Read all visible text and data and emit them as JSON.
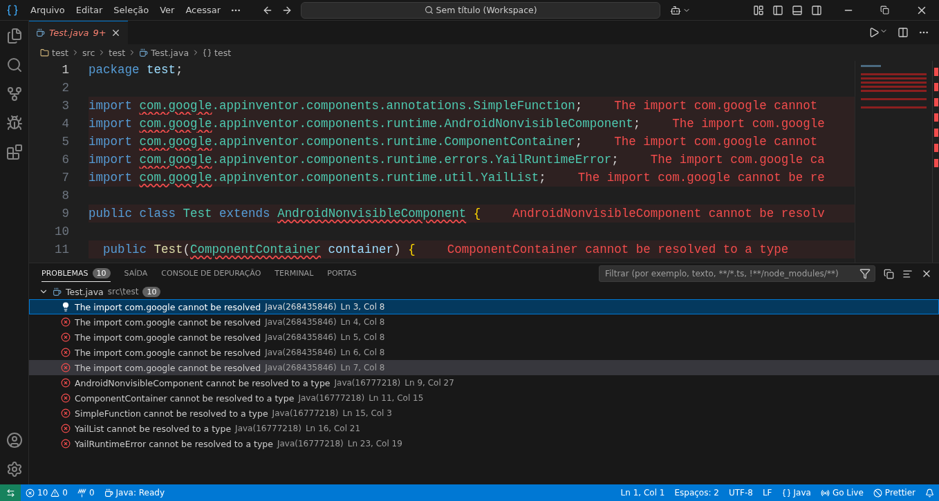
{
  "title_bar": {
    "menu": [
      "Arquivo",
      "Editar",
      "Seleção",
      "Ver",
      "Acessar"
    ],
    "command_center": "Sem título (Workspace)"
  },
  "editor_tabs": [
    {
      "label": "Test.java",
      "badge": "9+",
      "selected": true,
      "has_errors": true
    }
  ],
  "breadcrumb": [
    {
      "kind": "folder",
      "label": "test"
    },
    {
      "kind": "plain",
      "label": "src"
    },
    {
      "kind": "plain",
      "label": "test"
    },
    {
      "kind": "file",
      "label": "Test.java"
    },
    {
      "kind": "symbol",
      "label": "test"
    }
  ],
  "code_lines": [
    {
      "number": "1",
      "error_line": false,
      "tokens": [
        {
          "kind": "keyword",
          "text": "package"
        },
        {
          "kind": "variable",
          "text": "test"
        },
        {
          "kind": "plain",
          "text": ";",
          "attached": true
        }
      ]
    },
    {
      "number": "2",
      "error_line": false
    },
    {
      "number": "3",
      "error_line": true,
      "message": "The import com.google cannot",
      "tokens": [
        {
          "kind": "keyword",
          "text": "import"
        },
        {
          "kind": "type",
          "text": "com.google",
          "error": true
        },
        {
          "kind": "type",
          "text": ".appinventor.components.annotations.SimpleFunction",
          "attached": true
        },
        {
          "kind": "plain",
          "text": ";",
          "attached": true
        }
      ]
    },
    {
      "number": "4",
      "error_line": true,
      "message": "The import com.google",
      "tokens": [
        {
          "kind": "keyword",
          "text": "import"
        },
        {
          "kind": "type",
          "text": "com.google",
          "error": true
        },
        {
          "kind": "type",
          "text": ".appinventor.components.runtime.AndroidNonvisibleComponent",
          "attached": true
        },
        {
          "kind": "plain",
          "text": ";",
          "attached": true
        }
      ]
    },
    {
      "number": "5",
      "error_line": true,
      "message": "The import com.google cannot",
      "tokens": [
        {
          "kind": "keyword",
          "text": "import"
        },
        {
          "kind": "type",
          "text": "com.google",
          "error": true
        },
        {
          "kind": "type",
          "text": ".appinventor.components.runtime.ComponentContainer",
          "attached": true
        },
        {
          "kind": "plain",
          "text": ";",
          "attached": true
        }
      ]
    },
    {
      "number": "6",
      "error_line": true,
      "message": "The import com.google ca",
      "tokens": [
        {
          "kind": "keyword",
          "text": "import"
        },
        {
          "kind": "type",
          "text": "com.google",
          "error": true
        },
        {
          "kind": "type",
          "text": ".appinventor.components.runtime.errors.YailRuntimeError",
          "attached": true
        },
        {
          "kind": "plain",
          "text": ";",
          "attached": true
        }
      ]
    },
    {
      "number": "7",
      "error_line": true,
      "message": "The import com.google cannot be re",
      "tokens": [
        {
          "kind": "keyword",
          "text": "import"
        },
        {
          "kind": "type",
          "text": "com.google",
          "error": true
        },
        {
          "kind": "type",
          "text": ".appinventor.components.runtime.util.YailList",
          "attached": true
        },
        {
          "kind": "plain",
          "text": ";",
          "attached": true
        }
      ]
    },
    {
      "number": "8",
      "error_line": false
    },
    {
      "number": "9",
      "error_line": true,
      "message": "AndroidNonvisibleComponent cannot be resolv",
      "tokens": [
        {
          "kind": "keyword",
          "text": "public"
        },
        {
          "kind": "keyword",
          "text": "class"
        },
        {
          "kind": "type",
          "text": "Test"
        },
        {
          "kind": "keyword",
          "text": "extends"
        },
        {
          "kind": "type",
          "text": "AndroidNonvisibleComponent",
          "error": true
        },
        {
          "kind": "bracket",
          "text": "{"
        }
      ]
    },
    {
      "number": "10",
      "error_line": false
    },
    {
      "number": "11",
      "error_line": true,
      "indented": true,
      "message": "ComponentContainer cannot be resolved to a type",
      "tokens": [
        {
          "kind": "keyword",
          "text": "public"
        },
        {
          "kind": "method",
          "text": "Test"
        },
        {
          "kind": "plain",
          "text": "(",
          "attached": true
        },
        {
          "kind": "type",
          "text": "ComponentContainer",
          "error": true,
          "attached": true
        },
        {
          "kind": "variable",
          "text": "container"
        },
        {
          "kind": "plain",
          "text": ")",
          "attached": true
        },
        {
          "kind": "bracket",
          "text": "{"
        }
      ]
    }
  ],
  "panel": {
    "tabs": [
      {
        "label": "PROBLEMAS",
        "badge": "10",
        "selected": true
      },
      {
        "label": "SAÍDA",
        "selected": false
      },
      {
        "label": "CONSOLE DE DEPURAÇÃO",
        "selected": false
      },
      {
        "label": "TERMINAL",
        "selected": false
      },
      {
        "label": "PORTAS",
        "selected": false
      }
    ],
    "filter": {
      "placeholder": "Filtrar (por exemplo, texto, **/*.ts, !**/node_modules/**)"
    },
    "file_group": {
      "name": "Test.java",
      "path": "src\\test",
      "count": "10",
      "expanded": true
    },
    "problems": [
      {
        "kind": "quickfix",
        "message": "The import com.google cannot be resolved",
        "source": "Java(268435846)",
        "location": "Ln 3, Col 8",
        "selected": true,
        "hovered": false
      },
      {
        "kind": "error",
        "message": "The import com.google cannot be resolved",
        "source": "Java(268435846)",
        "location": "Ln 4, Col 8",
        "selected": false,
        "hovered": false
      },
      {
        "kind": "error",
        "message": "The import com.google cannot be resolved",
        "source": "Java(268435846)",
        "location": "Ln 5, Col 8",
        "selected": false,
        "hovered": false
      },
      {
        "kind": "error",
        "message": "The import com.google cannot be resolved",
        "source": "Java(268435846)",
        "location": "Ln 6, Col 8",
        "selected": false,
        "hovered": false
      },
      {
        "kind": "error",
        "message": "The import com.google cannot be resolved",
        "source": "Java(268435846)",
        "location": "Ln 7, Col 8",
        "selected": false,
        "hovered": true
      },
      {
        "kind": "error",
        "message": "AndroidNonvisibleComponent cannot be resolved to a type",
        "source": "Java(16777218)",
        "location": "Ln 9, Col 27",
        "selected": false,
        "hovered": false
      },
      {
        "kind": "error",
        "message": "ComponentContainer cannot be resolved to a type",
        "source": "Java(16777218)",
        "location": "Ln 11, Col 15",
        "selected": false,
        "hovered": false
      },
      {
        "kind": "error",
        "message": "SimpleFunction cannot be resolved to a type",
        "source": "Java(16777218)",
        "location": "Ln 15, Col 3",
        "selected": false,
        "hovered": false
      },
      {
        "kind": "error",
        "message": "YailList cannot be resolved to a type",
        "source": "Java(16777218)",
        "location": "Ln 16, Col 21",
        "selected": false,
        "hovered": false
      },
      {
        "kind": "error",
        "message": "YailRuntimeError cannot be resolved to a type",
        "source": "Java(16777218)",
        "location": "Ln 23, Col 19",
        "selected": false,
        "hovered": false
      }
    ]
  },
  "status_bar": {
    "left": [
      {
        "kind": "remote"
      },
      {
        "kind": "problems",
        "errors": "10",
        "warnings": "0"
      },
      {
        "kind": "ports",
        "text": "0"
      },
      {
        "kind": "java",
        "text": "Java: Ready"
      }
    ],
    "right": [
      {
        "kind": "text",
        "text": "Ln 1, Col 1"
      },
      {
        "kind": "text",
        "text": "Espaços: 2"
      },
      {
        "kind": "text",
        "text": "UTF-8"
      },
      {
        "kind": "text",
        "text": "LF"
      },
      {
        "kind": "language",
        "text": "Java"
      },
      {
        "kind": "golive",
        "text": "Go Live"
      },
      {
        "kind": "prettier",
        "text": "Prettier"
      },
      {
        "kind": "bell"
      }
    ]
  }
}
